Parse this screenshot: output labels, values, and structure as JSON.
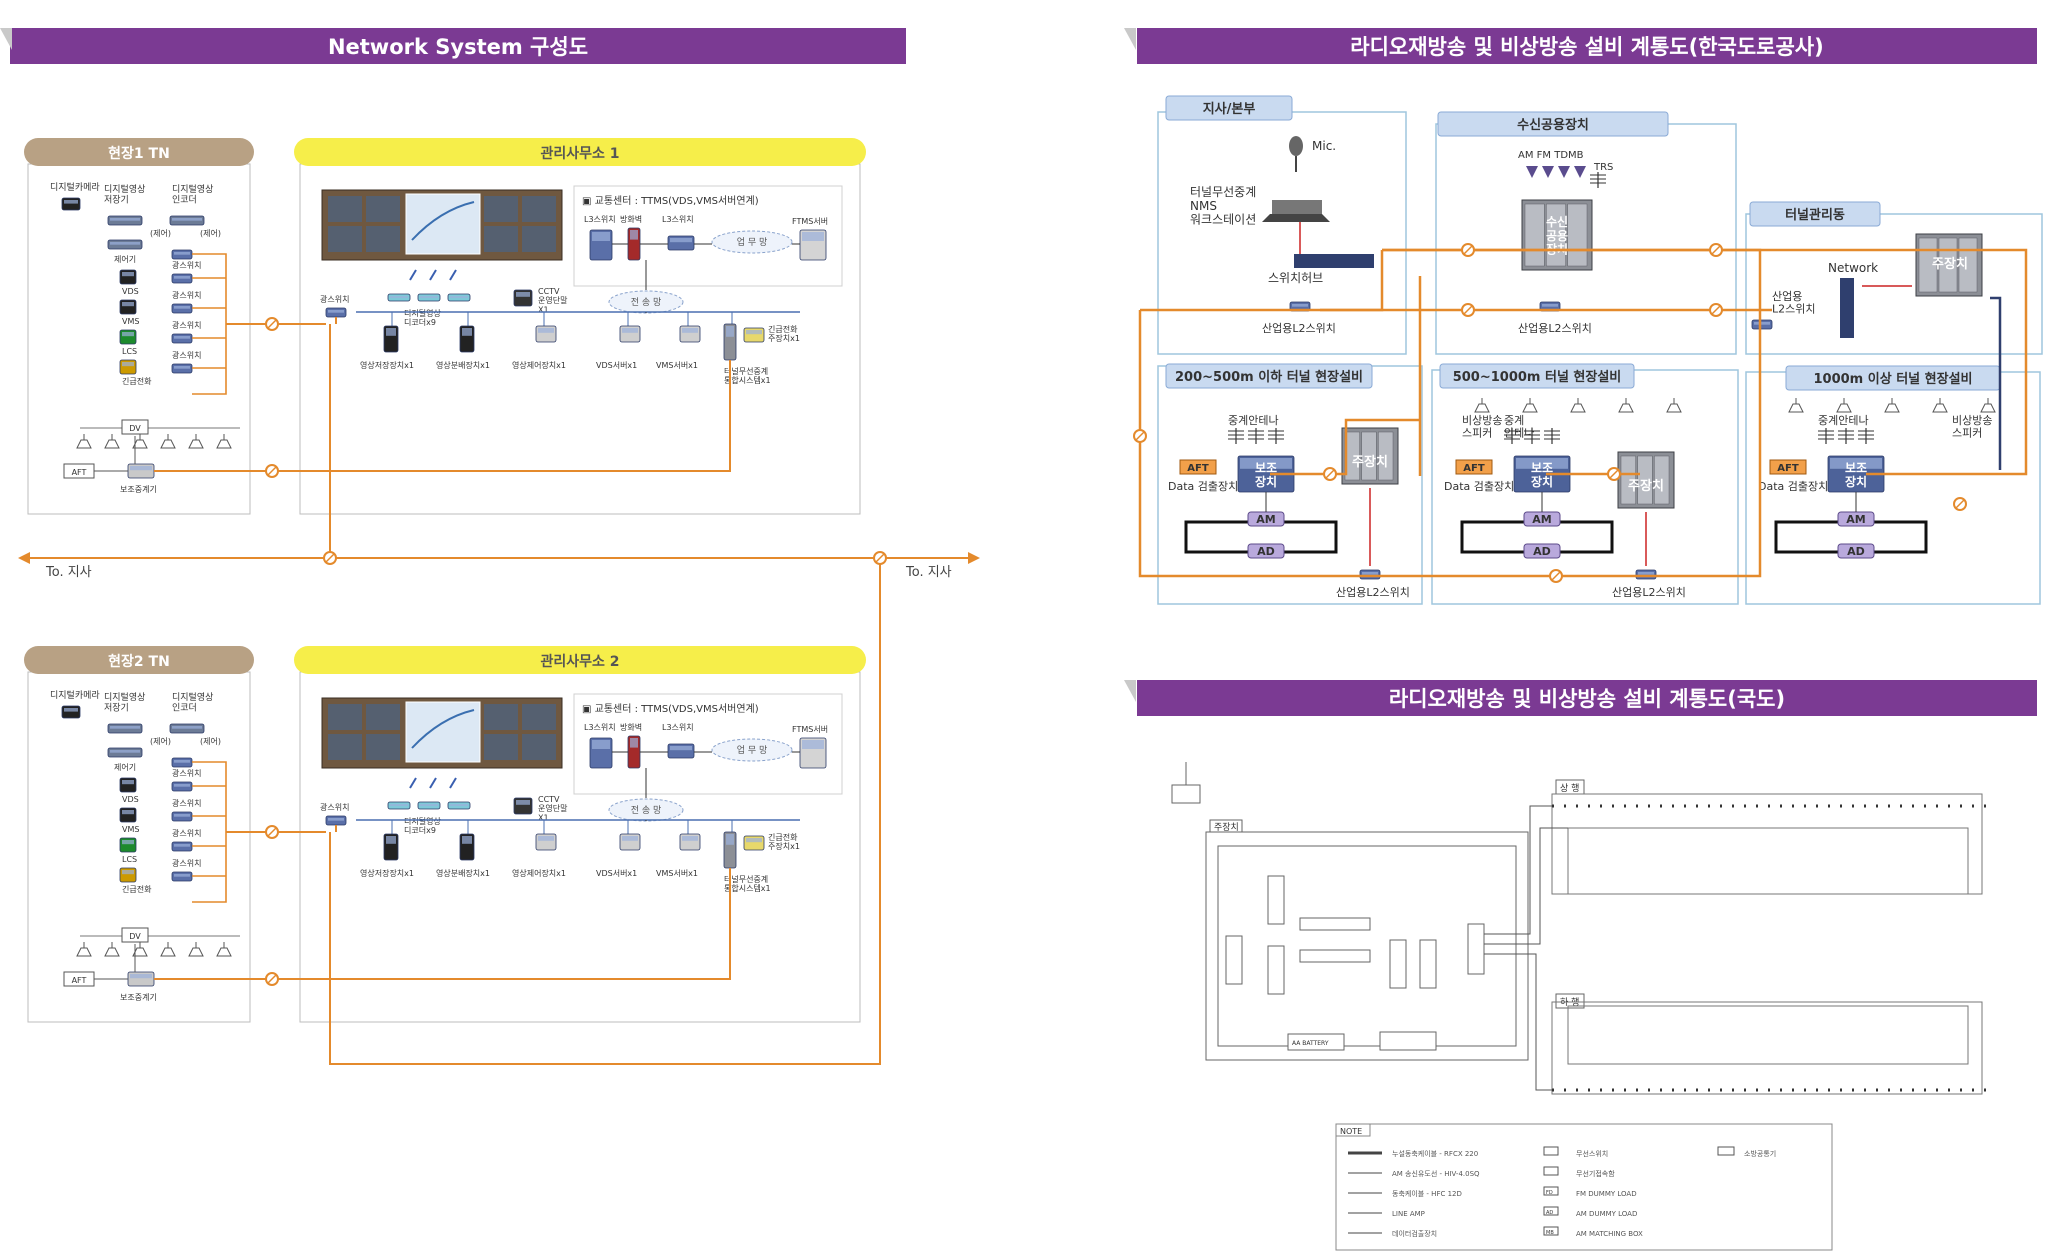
{
  "banners": {
    "network_title": "Network System 구성도",
    "radio_korea_title": "라디오재방송 및 비상방송 설비 계통도(한국도로공사)",
    "radio_national_title": "라디오재방송 및 비상방송 설비 계통도(국도)"
  },
  "network": {
    "sites": [
      {
        "site_label": "현장1 TN",
        "office_label": "관리사무소 1",
        "devices": [
          "디지털카메라",
          "디지털영상\n저장기",
          "디지털영상\n인코더",
          "(제어)",
          "(제어)",
          "제어기",
          "광스위치",
          "VDS",
          "광스위치",
          "VMS",
          "광스위치",
          "LCS",
          "광스위치",
          "긴급전화",
          "광스위치"
        ],
        "dv": "DV",
        "aft": "AFT",
        "aux_repeater": "보조중계기",
        "office_switch": "광스위치",
        "decoder": "디지털영상\n디코더x9",
        "cctv_terminal": "CCTV\n운영단말\nX1",
        "traffic_center": "교통센터 : TTMS(VDS,VMS서버연계)",
        "l3_switch_a": "L3스위치",
        "firewall": "방화벽",
        "l3_switch_b": "L3스위치",
        "wan": "업 무 망",
        "ftms_server": "FTMS서버",
        "transmission": "전 송 망",
        "bottom_devices": [
          "영상저장장치x1",
          "영상분배장치x1",
          "영상제어장치x1",
          "VDS서버x1",
          "VMS서버x1"
        ],
        "emergency_phone_host": "긴급전화\n주장치x1",
        "tunnel_radio": "터널무선중계\n통합시스템x1"
      },
      {
        "site_label": "현장2 TN",
        "office_label": "관리사무소 2",
        "devices": [
          "디지털카메라",
          "디지털영상\n저장기",
          "디지털영상\n인코더",
          "(제어)",
          "(제어)",
          "제어기",
          "광스위치",
          "VDS",
          "광스위치",
          "VMS",
          "광스위치",
          "LCS",
          "광스위치",
          "긴급전화",
          "광스위치"
        ],
        "dv": "DV",
        "aft": "AFT",
        "aux_repeater": "보조중계기",
        "office_switch": "광스위치",
        "decoder": "디지털영상\n디코더x9",
        "cctv_terminal": "CCTV\n운영단말\nX1",
        "traffic_center": "교통센터 : TTMS(VDS,VMS서버연계)",
        "l3_switch_a": "L3스위치",
        "firewall": "방화벽",
        "l3_switch_b": "L3스위치",
        "wan": "업 무 망",
        "ftms_server": "FTMS서버",
        "transmission": "전 송 망",
        "bottom_devices": [
          "영상저장장치x1",
          "영상분배장치x1",
          "영상제어장치x1",
          "VDS서버x1",
          "VMS서버x1"
        ],
        "emergency_phone_host": "긴급전화\n주장치x1",
        "tunnel_radio": "터널무선중계\n통합시스템x1"
      }
    ],
    "to_branch_left": "To. 지사",
    "to_branch_right": "To. 지사"
  },
  "radio_korea": {
    "branch_box": "지사/본부",
    "mic": "Mic.",
    "nms": "터널무선중계\nNMS\n워크스테이션",
    "switch_hub": "스위치허브",
    "l2_switch_1": "산업용L2스위치",
    "receiver_box": "수신공용장치",
    "bands": "AM FM TDMB",
    "trs": "TRS",
    "receiver_device": "수신\n공용\n장치",
    "l2_switch_2": "산업용L2스위치",
    "tunnel_mgmt": "터널관리동",
    "network": "Network",
    "l2_switch_3": "산업용\nL2스위치",
    "main_device_top": "주장치",
    "zones": [
      {
        "title": "200~500m 이하 터널 현장설비",
        "antenna": "중계안테나",
        "speaker": "",
        "aft": "AFT",
        "detector": "Data 검출장치",
        "aux": "보조\n장치",
        "am": "AM",
        "ad": "AD",
        "main": "주장치",
        "l2": "산업용L2스위치"
      },
      {
        "title": "500~1000m 터널 현장설비",
        "antenna": "중계\n안테나",
        "speaker": "비상방송\n스피커",
        "aft": "AFT",
        "detector": "Data 검출장치",
        "aux": "보조\n장치",
        "am": "AM",
        "ad": "AD",
        "main": "주장치",
        "l2": "산업용L2스위치"
      },
      {
        "title": "1000m 이상 터널 현장설비",
        "antenna": "중계안테나",
        "speaker": "비상방송\n스피커",
        "aft": "AFT",
        "detector": "Data 검출장치",
        "aux": "보조\n장치",
        "am": "AM",
        "ad": "AD",
        "main": "",
        "l2": ""
      }
    ]
  },
  "radio_national": {
    "main_device": "주장치",
    "upper": "상 행",
    "lower": "하 행",
    "note": "NOTE",
    "legend": [
      [
        "누설동축케이블 - RFCX 220",
        "무선스위치",
        "소방공통기"
      ],
      [
        "AM 송신유도선 - HIV-4.0SQ",
        "무선기접속함",
        ""
      ],
      [
        "동축케이블 - HFC 12D",
        "FM DUMMY LOAD",
        ""
      ],
      [
        "LINE AMP",
        "AM DUMMY LOAD",
        ""
      ],
      [
        "데이터검출장치",
        "AM MATCHING BOX",
        ""
      ]
    ],
    "legend_codes": [
      "FD",
      "AD",
      "MB"
    ],
    "battery": "AA BATTERY"
  },
  "colors": {
    "purple": "#7b3a93",
    "orange": "#e48a2c",
    "site_tab": "#b8a184",
    "office_tab": "#f6ee4a",
    "blue_frame": "#9fc6dd",
    "device": "#54689c"
  }
}
